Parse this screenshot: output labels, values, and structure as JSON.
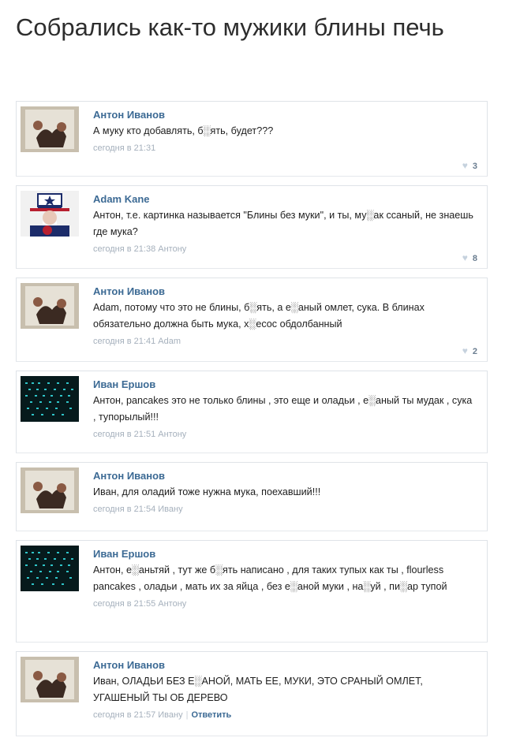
{
  "post": {
    "title": "Собрались как-то мужики блины печь"
  },
  "comments": [
    {
      "author": "Антон Иванов",
      "text": "А муку кто добавлять, б░ять, будет???",
      "meta": "сегодня в 21:31",
      "likes": "3",
      "avatar": "uncle-sam-hands"
    },
    {
      "author": "Adam Kane",
      "text": "Антон, т.е. картинка называется \"Блины без муки\", и ты, му░ак ссаный, не знаешь где мука?",
      "meta": "сегодня в 21:38 Антону",
      "likes": "8",
      "avatar": "uncle-sam"
    },
    {
      "author": "Антон Иванов",
      "text": "Adam, потому что это не блины, б░ять, а е░аный омлет, сука. В блинах обязательно должна быть мука, х░есос обдолбанный",
      "meta": "сегодня в 21:41 Adam",
      "likes": "2",
      "avatar": "uncle-sam-hands"
    },
    {
      "author": "Иван Ершов",
      "text": "Антон, pancakes это не только блины , это еще и оладьи , е░аный ты мудак , сука , тупорылый!!!",
      "meta": "сегодня в 21:51 Антону",
      "likes": "",
      "avatar": "matrix"
    },
    {
      "author": "Антон Иванов",
      "text": "Иван, для оладий тоже нужна мука, поехавший!!!",
      "meta": "сегодня в 21:54 Ивану",
      "likes": "",
      "avatar": "uncle-sam-hands"
    },
    {
      "author": "Иван Ершов",
      "text": "Антон, е░аньтяй , тут же б░ять написано , для таких тупых как ты , flourless pancakes , оладьи , мать их за яйца , без е░аной муки , на░уй , пи░ар тупой",
      "meta": "сегодня в 21:55 Антону",
      "likes": "",
      "avatar": "matrix"
    },
    {
      "author": "Антон Иванов",
      "text": "Иван, ОЛАДЬИ БЕЗ Е░АНОЙ, МАТЬ ЕЕ, МУКИ, ЭТО СРАНЫЙ ОМЛЕТ, УГАШЕНЫЙ ТЫ ОБ ДЕРЕВО",
      "meta": "сегодня в 21:57 Ивану",
      "reply": "Ответить",
      "likes": "",
      "avatar": "uncle-sam-hands"
    }
  ],
  "colors": {
    "author": "#3c6a94",
    "meta": "#a5b0bc",
    "border": "#dfe3e8"
  }
}
